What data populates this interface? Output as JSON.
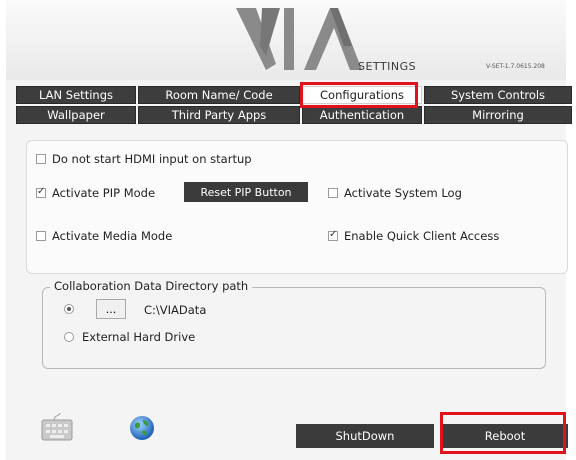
{
  "header": {
    "logo_text": "VIA",
    "settings_label": "SETTINGS",
    "version": "V-SET-1.7.0615.208"
  },
  "tabs_row1": [
    "LAN Settings",
    "Room Name/ Code",
    "Configurations",
    "System Controls"
  ],
  "tabs_row2": [
    "Wallpaper",
    "Third Party Apps",
    "Authentication",
    "Mirroring"
  ],
  "active_tab": "Configurations",
  "options": {
    "hdmi": {
      "label": "Do not start HDMI input on startup",
      "checked": false
    },
    "pip": {
      "label": "Activate PIP Mode",
      "checked": true
    },
    "reset_pip": "Reset PIP Button",
    "syslog": {
      "label": "Activate System Log",
      "checked": false
    },
    "media": {
      "label": "Activate Media Mode",
      "checked": false
    },
    "quick": {
      "label": "Enable Quick Client Access",
      "checked": true
    }
  },
  "collab": {
    "legend": "Collaboration Data Directory path",
    "browse_label": "...",
    "path_value": "C:\\VIAData",
    "external_label": "External Hard Drive",
    "selected": "path"
  },
  "footer": {
    "shutdown": "ShutDown",
    "reboot": "Reboot"
  },
  "icons": {
    "keyboard": "keyboard-icon",
    "globe": "globe-icon"
  },
  "colors": {
    "dark_button": "#3b3b3b",
    "highlight": "#e0131c"
  }
}
